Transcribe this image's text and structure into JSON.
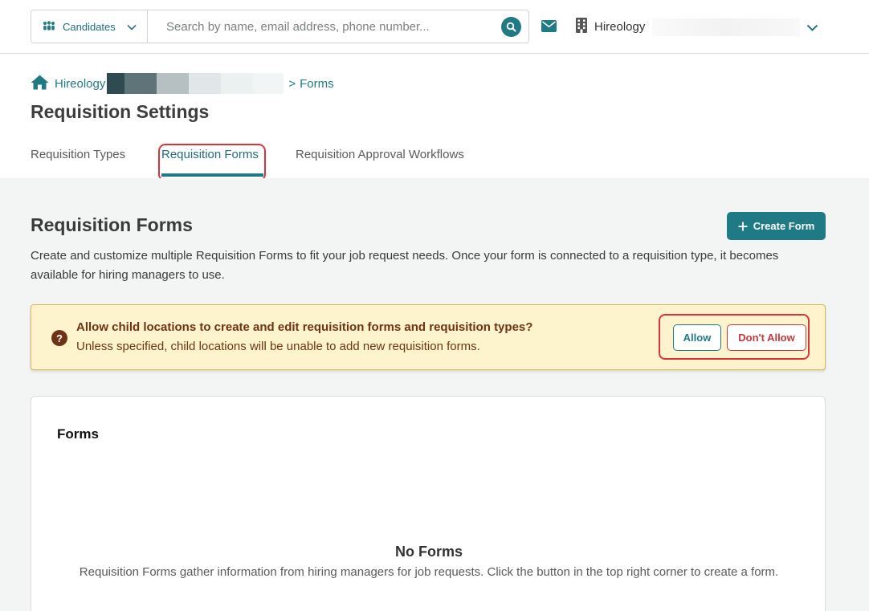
{
  "topbar": {
    "candidates_label": "Candidates",
    "search_placeholder": "Search by name, email address, phone number...",
    "org_name": "Hireology"
  },
  "breadcrumb": {
    "home_label": "Hireology",
    "separator": ">",
    "current": "Forms"
  },
  "page_title": "Requisition Settings",
  "tabs": [
    {
      "label": "Requisition Types",
      "active": false
    },
    {
      "label": "Requisition Forms",
      "active": true
    },
    {
      "label": "Requisition Approval Workflows",
      "active": false
    }
  ],
  "section": {
    "title": "Requisition Forms",
    "create_button": "Create Form",
    "description": "Create and customize multiple Requisition Forms to fit your job request needs. Once your form is connected to a requisition type, it becomes available for hiring managers to use."
  },
  "banner": {
    "icon": "?",
    "heading": "Allow child locations to create and edit requisition forms and requisition types?",
    "subtext": "Unless specified, child locations will be unable to add new requisition forms.",
    "allow_label": "Allow",
    "deny_label": "Don't Allow"
  },
  "forms_card": {
    "title": "Forms",
    "empty_title": "No Forms",
    "empty_message": "Requisition Forms gather information from hiring managers for job requests. Click the button in the top right corner to create a form."
  },
  "colors": {
    "brand": "#1f7a86",
    "warning_bg": "#fdf3cc",
    "warning_text": "#6e3314",
    "danger": "#c5373d",
    "highlight": "#d9343c"
  }
}
